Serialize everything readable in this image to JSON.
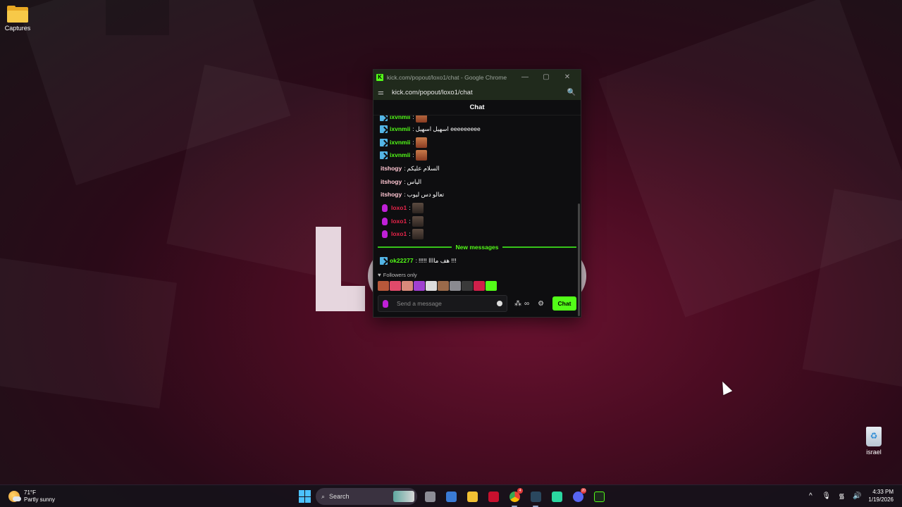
{
  "desktop": {
    "icons": [
      {
        "label": "Captures"
      },
      {
        "label": "israel"
      }
    ]
  },
  "chrome_window": {
    "title": "kick.com/popout/loxo1/chat - Google Chrome",
    "url": "kick.com/popout/loxo1/chat",
    "favicon_letter": "K",
    "minimize_symbol": "—",
    "maximize_symbol": "▢",
    "close_symbol": "✕"
  },
  "chat": {
    "header": "Chat",
    "messages": [
      {
        "username": "ixvnmii",
        "separator": ":",
        "text": "",
        "badge": "bot",
        "emote": "face1"
      },
      {
        "username": "ixvnmii",
        "separator": ":",
        "text": "اسهيل اسهيل eeeeeeeee",
        "badge": "bot",
        "emote": ""
      },
      {
        "username": "ixvnmii",
        "separator": ":",
        "text": "",
        "badge": "bot",
        "emote": "face1"
      },
      {
        "username": "ixvnmii",
        "separator": ":",
        "text": "",
        "badge": "bot",
        "emote": "face1"
      },
      {
        "username": "itshogy",
        "separator": ":",
        "text": "السلام عليكم",
        "badge": "",
        "emote": ""
      },
      {
        "username": "itshogy",
        "separator": ":",
        "text": "الياس",
        "badge": "",
        "emote": ""
      },
      {
        "username": "itshogy",
        "separator": ":",
        "text": "تعالو دس ليوب",
        "badge": "",
        "emote": ""
      },
      {
        "username": "loxo1",
        "separator": ":",
        "text": "",
        "badge": "mic",
        "emote": "face2"
      },
      {
        "username": "loxo1",
        "separator": ":",
        "text": "",
        "badge": "mic",
        "emote": "face2"
      },
      {
        "username": "loxo1",
        "separator": ":",
        "text": "",
        "badge": "mic",
        "emote": "face2"
      }
    ],
    "new_messages_label": "New messages",
    "after_new": {
      "username": "ok22277",
      "separator": ":",
      "text": "!!!!! هف ماااا !!!",
      "badge": "bot"
    },
    "followers_only_label": "Followers only",
    "input_placeholder": "Send a message",
    "send_button": "Chat",
    "extra_symbol": "∞",
    "settings_symbol": "⚙"
  },
  "taskbar": {
    "weather_temp": "71°F",
    "weather_desc": "Partly sunny",
    "search_label": "Search",
    "time": "4:33 PM",
    "date": "1/19/2026",
    "tray": {
      "chevron": "^",
      "mic": "🎙",
      "wifi": "᯾",
      "volume": "🔊"
    },
    "apps": [
      {
        "name": "file-manager",
        "color": "#7d7d86"
      },
      {
        "name": "shield-app",
        "color": "#3a7bd5"
      },
      {
        "name": "file-explorer",
        "color": "#f2c033"
      },
      {
        "name": "amd-software",
        "color": "#c8102e"
      },
      {
        "name": "chrome",
        "color": "#4285f4",
        "badge": "4"
      },
      {
        "name": "steam",
        "color": "#1b2838"
      },
      {
        "name": "game-app",
        "color": "#2bd6a0"
      },
      {
        "name": "discord",
        "color": "#5865f2",
        "badge": "20"
      },
      {
        "name": "terminal",
        "color": "#1c2a1c"
      }
    ]
  }
}
